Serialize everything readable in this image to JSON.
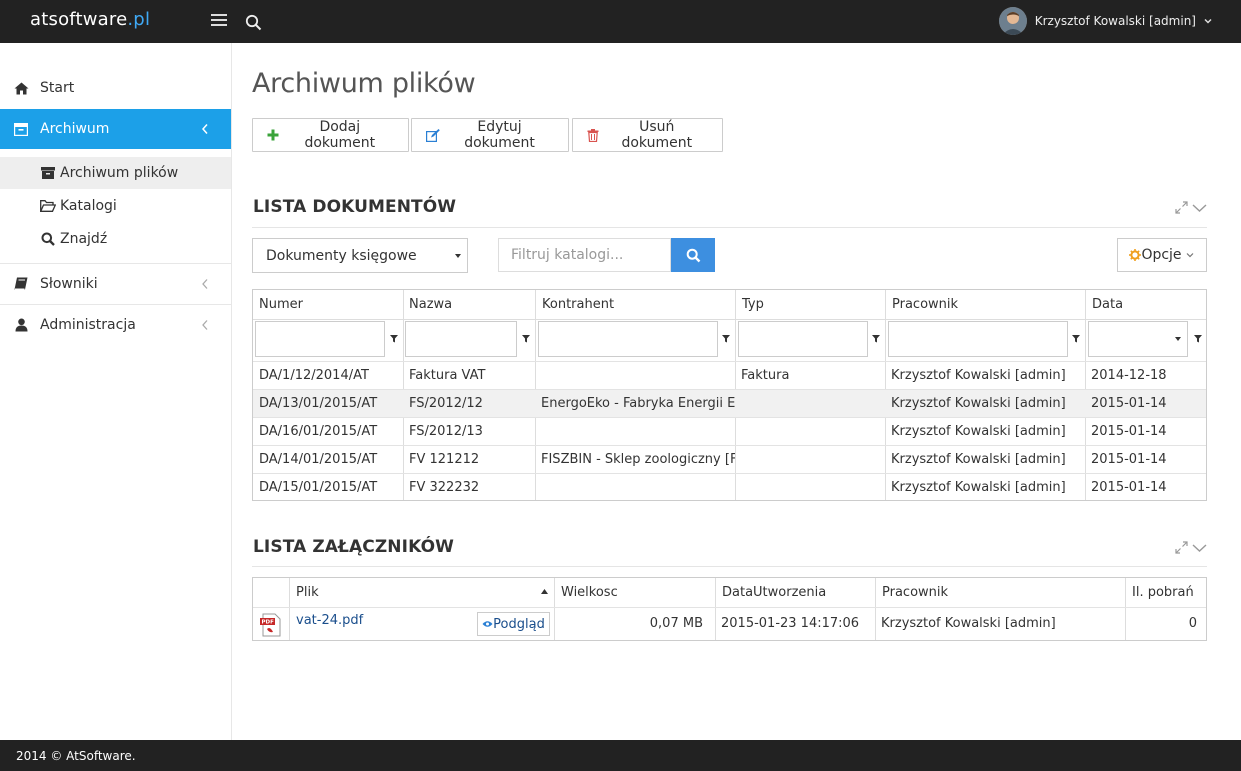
{
  "header": {
    "brand_main": "atsoftware",
    "brand_tld": ".pl",
    "user_name": "Krzysztof Kowalski [admin]"
  },
  "sidebar": {
    "items": [
      {
        "label": "Start",
        "icon": "home-icon"
      },
      {
        "label": "Archiwum",
        "icon": "archive-icon",
        "active": true
      },
      {
        "label": "Słowniki",
        "icon": "book-icon"
      },
      {
        "label": "Administracja",
        "icon": "user-icon"
      }
    ],
    "subitems": [
      {
        "label": "Archiwum plików",
        "icon": "archive-box-icon",
        "current": true
      },
      {
        "label": "Katalogi",
        "icon": "folder-open-icon"
      },
      {
        "label": "Znajdź",
        "icon": "search-icon"
      }
    ]
  },
  "page": {
    "title": "Archiwum plików",
    "buttons": {
      "add": "Dodaj dokument",
      "edit": "Edytuj dokument",
      "delete": "Usuń dokument"
    }
  },
  "documents": {
    "title": "LISTA DOKUMENTÓW",
    "select_value": "Dokumenty księgowe",
    "filter_placeholder": "Filtruj katalogi...",
    "options_label": "Opcje",
    "columns": [
      "Numer",
      "Nazwa",
      "Kontrahent",
      "Typ",
      "Pracownik",
      "Data"
    ],
    "rows": [
      [
        "DA/1/12/2014/AT",
        "Faktura VAT",
        "",
        "Faktura",
        "Krzysztof Kowalski [admin]",
        "2014-12-18"
      ],
      [
        "DA/13/01/2015/AT",
        "FS/2012/12",
        "EnergoEko - Fabryka Energii Ekologicznej",
        "",
        "Krzysztof Kowalski [admin]",
        "2015-01-14"
      ],
      [
        "DA/16/01/2015/AT",
        "FS/2012/13",
        "",
        "",
        "Krzysztof Kowalski [admin]",
        "2015-01-14"
      ],
      [
        "DA/14/01/2015/AT",
        "FV 121212",
        "FISZBIN - Sklep zoologiczny [Fiszbin]",
        "",
        "Krzysztof Kowalski [admin]",
        "2015-01-14"
      ],
      [
        "DA/15/01/2015/AT",
        "FV 322232",
        "",
        "",
        "Krzysztof Kowalski [admin]",
        "2015-01-14"
      ]
    ]
  },
  "attachments": {
    "title": "LISTA ZAŁĄCZNIKÓW",
    "columns": [
      "Plik",
      "Wielkosc",
      "DataUtworzenia",
      "Pracownik",
      "Il. pobrań"
    ],
    "preview_label": "Podgląd",
    "rows": [
      {
        "file": "vat-24.pdf",
        "size": "0,07 MB",
        "created": "2015-01-23 14:17:06",
        "employee": "Krzysztof Kowalski [admin]",
        "downloads": "0",
        "icon": "pdf-file-icon"
      }
    ]
  },
  "footer": {
    "text": "2014 © AtSoftware."
  },
  "colors": {
    "topbar": "#222222",
    "accent": "#1ca0e8",
    "search_button": "#3d8fe0",
    "add_icon": "#3aa33a",
    "edit_icon": "#2a7fd4",
    "delete_icon": "#d9534f"
  }
}
